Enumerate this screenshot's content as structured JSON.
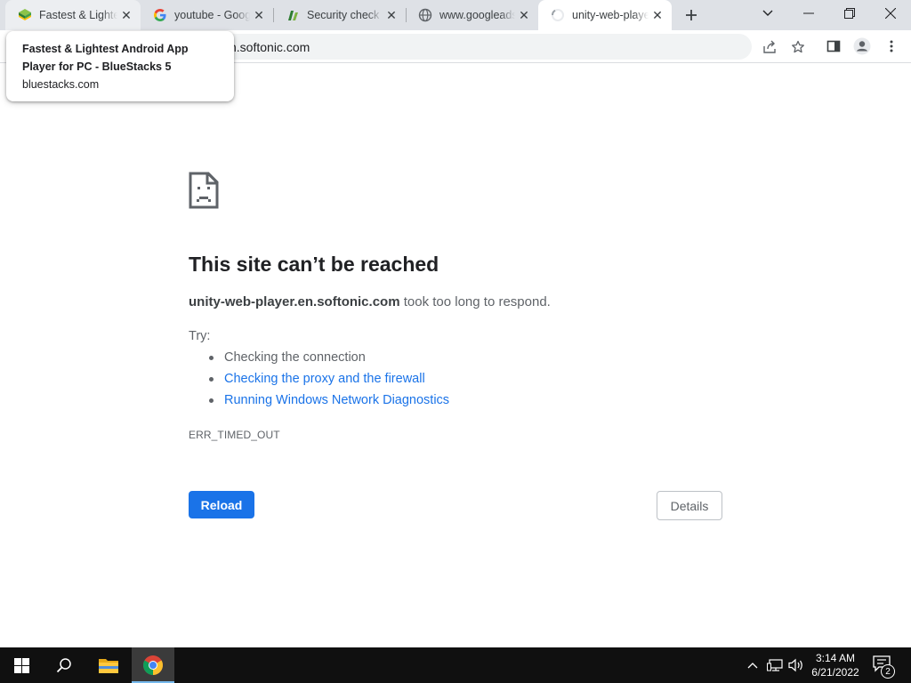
{
  "tabs": [
    {
      "title": "Fastest & Lightest Android App Player for PC - BlueStacks 5",
      "icon": "bluestacks-icon"
    },
    {
      "title": "youtube - Google Search",
      "icon": "google-g-icon"
    },
    {
      "title": "Security check",
      "icon": "security-check-icon"
    },
    {
      "title": "www.googleadservices.com",
      "icon": "globe-icon"
    },
    {
      "title": "unity-web-player.en.softonic.com",
      "icon": "loading-spinner-icon"
    }
  ],
  "omnibox": {
    "url": "unity-web-player.en.softonic.com",
    "visible_url": "n.softonic.com"
  },
  "hovercard": {
    "title": "Fastest & Lightest Android App Player for PC - BlueStacks 5",
    "domain": "bluestacks.com"
  },
  "error_page": {
    "heading": "This site can’t be reached",
    "host": "unity-web-player.en.softonic.com",
    "desc_suffix": " took too long to respond.",
    "try_label": "Try:",
    "suggestions": [
      {
        "text": "Checking the connection",
        "link": false
      },
      {
        "text": "Checking the proxy and the firewall",
        "link": true
      },
      {
        "text": "Running Windows Network Diagnostics",
        "link": true
      }
    ],
    "error_code": "ERR_TIMED_OUT",
    "reload_label": "Reload",
    "details_label": "Details"
  },
  "taskbar": {
    "time": "3:14 AM",
    "date": "6/21/2022",
    "notification_count": "2"
  },
  "colors": {
    "accent_blue": "#1a73e8",
    "tabstrip_bg": "#dee1e6",
    "taskbar_bg": "#101010"
  }
}
